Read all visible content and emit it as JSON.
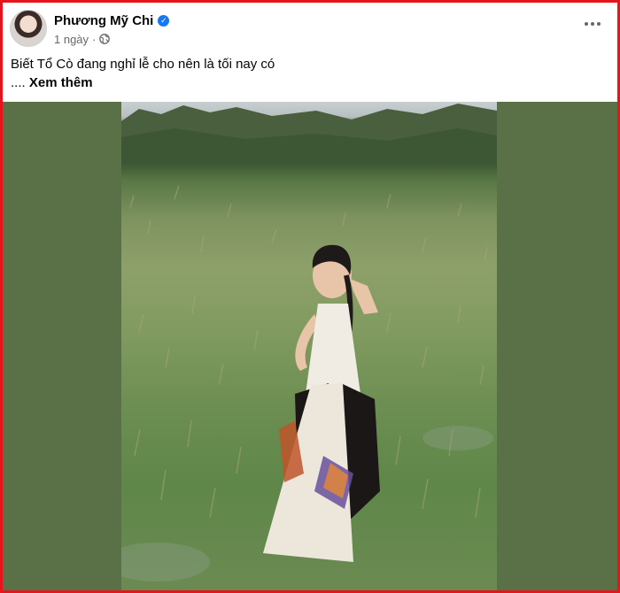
{
  "post": {
    "author": "Phương Mỹ Chi",
    "time": "1 ngày",
    "dot": "·",
    "text": "Biết Tổ Cò đang nghỉ lễ cho nên là tối nay có",
    "ellipsis": "....",
    "see_more": "Xem thêm",
    "privacy_icon": "globe-icon",
    "verified_icon": "verified-badge-icon"
  },
  "colors": {
    "frame_border": "#e8141c",
    "media_background": "#5a7148",
    "verified": "#1877f2",
    "meta_text": "#65676b"
  }
}
